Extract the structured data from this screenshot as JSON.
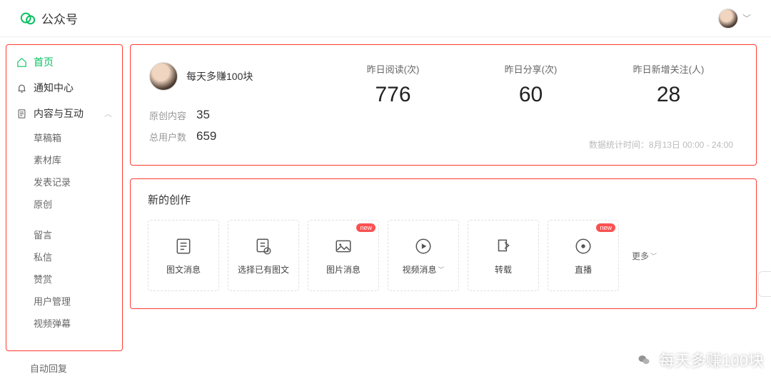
{
  "brand": "公众号",
  "sidebar": {
    "home": "首页",
    "notify": "通知中心",
    "content_group": "内容与互动",
    "subs": [
      "草稿箱",
      "素材库",
      "发表记录",
      "原创"
    ],
    "subs2": [
      "留言",
      "私信",
      "赞赏",
      "用户管理",
      "视频弹幕"
    ],
    "auto_reply": "自动回复"
  },
  "account": {
    "name": "每天多赚100块",
    "original_label": "原创内容",
    "original_value": "35",
    "users_label": "总用户数",
    "users_value": "659"
  },
  "metrics": {
    "reads_label": "昨日阅读(次)",
    "reads_value": "776",
    "shares_label": "昨日分享(次)",
    "shares_value": "60",
    "follows_label": "昨日新增关注(人)",
    "follows_value": "28",
    "note": "数据统计时间：8月13日 00:00 - 24:00"
  },
  "create": {
    "title": "新的创作",
    "tiles": [
      {
        "label": "图文消息"
      },
      {
        "label": "选择已有图文"
      },
      {
        "label": "图片消息",
        "new": true
      },
      {
        "label": "视频消息",
        "dropdown": true
      },
      {
        "label": "转载"
      },
      {
        "label": "直播",
        "new": true
      }
    ],
    "more": "更多",
    "new_badge": "new"
  },
  "watermark": "每天多赚100块"
}
